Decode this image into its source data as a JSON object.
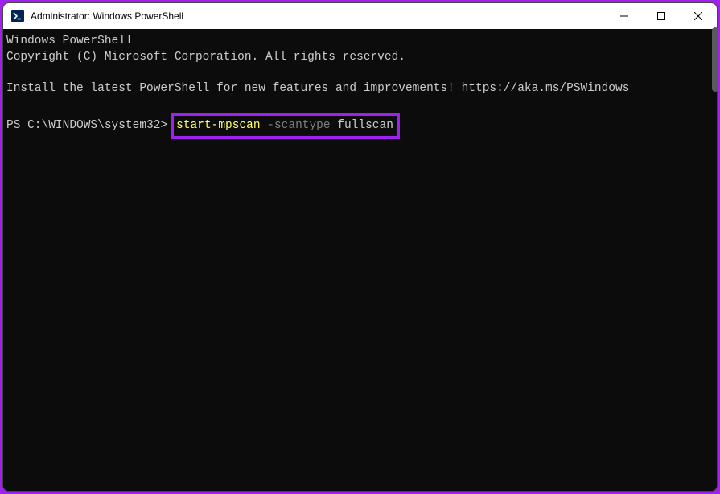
{
  "window": {
    "title": "Administrator: Windows PowerShell"
  },
  "terminal": {
    "line1": "Windows PowerShell",
    "line2": "Copyright (C) Microsoft Corporation. All rights reserved.",
    "line3": "Install the latest PowerShell for new features and improvements! https://aka.ms/PSWindows",
    "prompt": "PS C:\\WINDOWS\\system32>",
    "cmd_name": "start-mpscan",
    "cmd_param": " -scantype",
    "cmd_value": " fullscan"
  }
}
